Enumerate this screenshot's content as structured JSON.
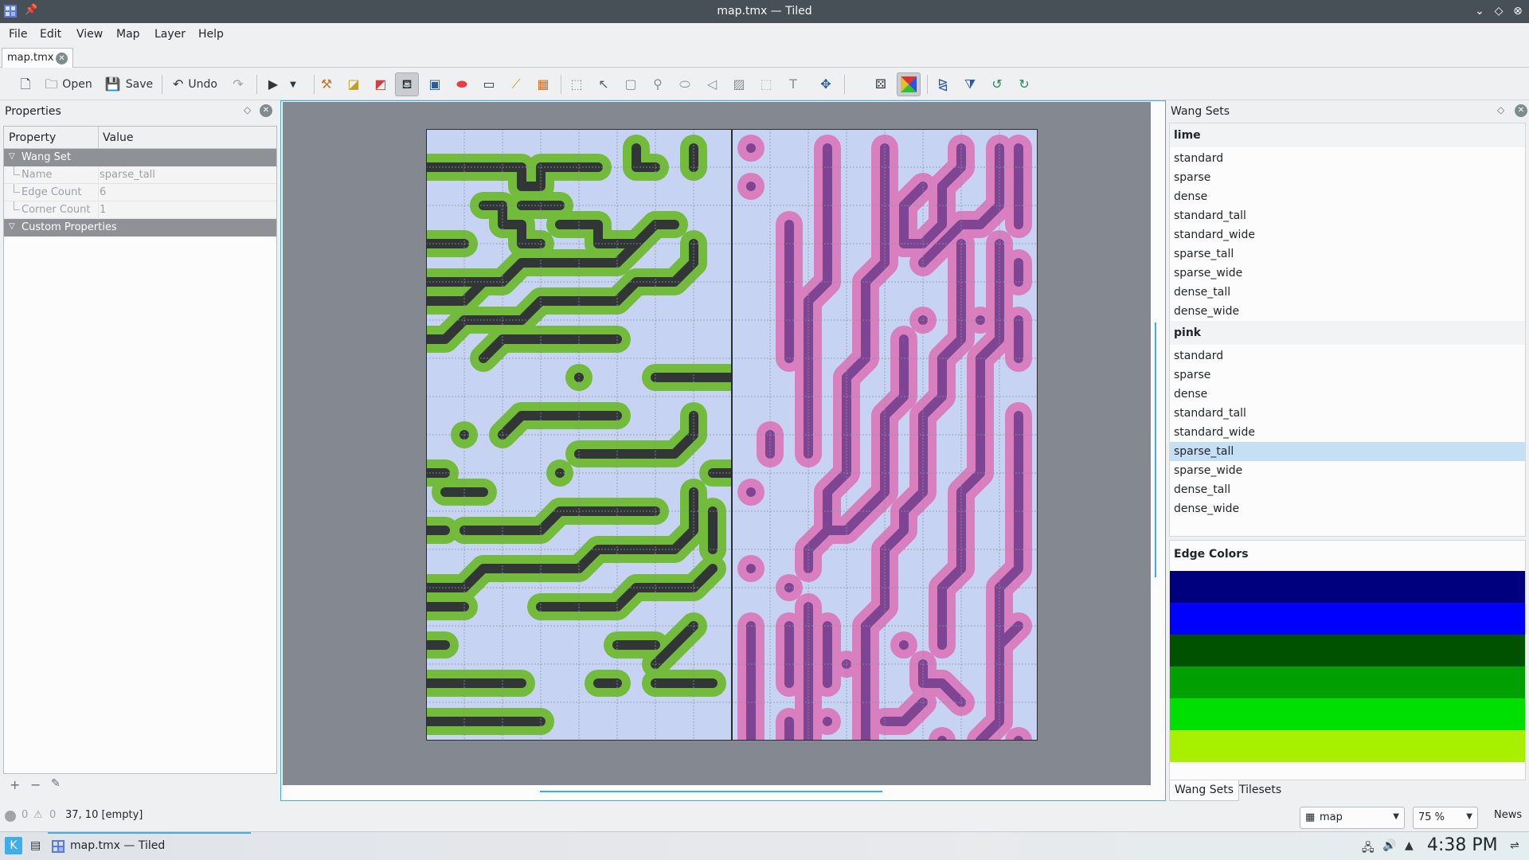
{
  "window": {
    "title": "map.tmx — Tiled",
    "pin_icon": "pin-icon",
    "controls": [
      "minimize-icon",
      "maximize-icon",
      "close-icon"
    ]
  },
  "menu": {
    "items": [
      "File",
      "Edit",
      "View",
      "Map",
      "Layer",
      "Help"
    ]
  },
  "document_tab": {
    "label": "map.tmx"
  },
  "toolbar": {
    "open_label": "Open",
    "save_label": "Save",
    "undo_label": "Undo",
    "tools": [
      "new-map-icon",
      "open-icon",
      "save-icon",
      "undo-icon",
      "redo-icon",
      "command-button-icon",
      "stamp-brush-icon",
      "terrain-brush-icon",
      "wang-brush-icon",
      "bucket-fill-icon",
      "shape-fill-icon",
      "eraser-icon",
      "rect-select-icon",
      "magic-wand-icon",
      "select-same-tile-icon",
      "select-objects-icon",
      "edit-polygons-icon",
      "insert-rectangle-icon",
      "insert-point-icon",
      "insert-ellipse-icon",
      "insert-polygon-icon",
      "insert-tile-icon",
      "insert-template-icon",
      "insert-text-icon",
      "layer-offset-icon",
      "random-mode-icon",
      "wang-fill-mode-icon",
      "flip-horizontal-icon",
      "flip-vertical-icon",
      "rotate-left-icon",
      "rotate-right-icon"
    ]
  },
  "properties": {
    "title": "Properties",
    "col_property": "Property",
    "col_value": "Value",
    "group_wangset": "Wang Set",
    "rows": [
      {
        "key": "Name",
        "value": "sparse_tall"
      },
      {
        "key": "Edge Count",
        "value": "6"
      },
      {
        "key": "Corner Count",
        "value": "1"
      }
    ],
    "group_custom": "Custom Properties"
  },
  "map": {
    "grid_cols": 16,
    "grid_rows": 16,
    "colors": {
      "background": "#c7d3f2",
      "grid": "#8a93a6",
      "lime_outer": "#72bb3b",
      "lime_inner": "#333637",
      "pink_outer": "#d97fc0",
      "pink_inner": "#7d4592"
    }
  },
  "wang_sets": {
    "title": "Wang Sets",
    "groups": [
      {
        "name": "lime",
        "items": [
          "standard",
          "sparse",
          "dense",
          "standard_tall",
          "standard_wide",
          "sparse_tall",
          "sparse_wide",
          "dense_tall",
          "dense_wide"
        ]
      },
      {
        "name": "pink",
        "items": [
          "standard",
          "sparse",
          "dense",
          "standard_tall",
          "standard_wide",
          "sparse_tall",
          "sparse_wide",
          "dense_tall",
          "dense_wide"
        ]
      }
    ],
    "selected": "pink.sparse_tall",
    "edge_colors_title": "Edge Colors",
    "edge_colors": [
      "#00007f",
      "#0000ff",
      "#005200",
      "#00a000",
      "#00e000",
      "#a8f000"
    ],
    "tabs": [
      "Wang Sets",
      "Tilesets"
    ]
  },
  "status": {
    "errors": "0",
    "warnings": "0",
    "cursor": "37, 10 [empty]",
    "layer_combo": "map",
    "zoom_combo": "75 %",
    "news": "News"
  },
  "taskbar": {
    "task_label": "map.tmx — Tiled",
    "clock": "4:38 PM"
  }
}
